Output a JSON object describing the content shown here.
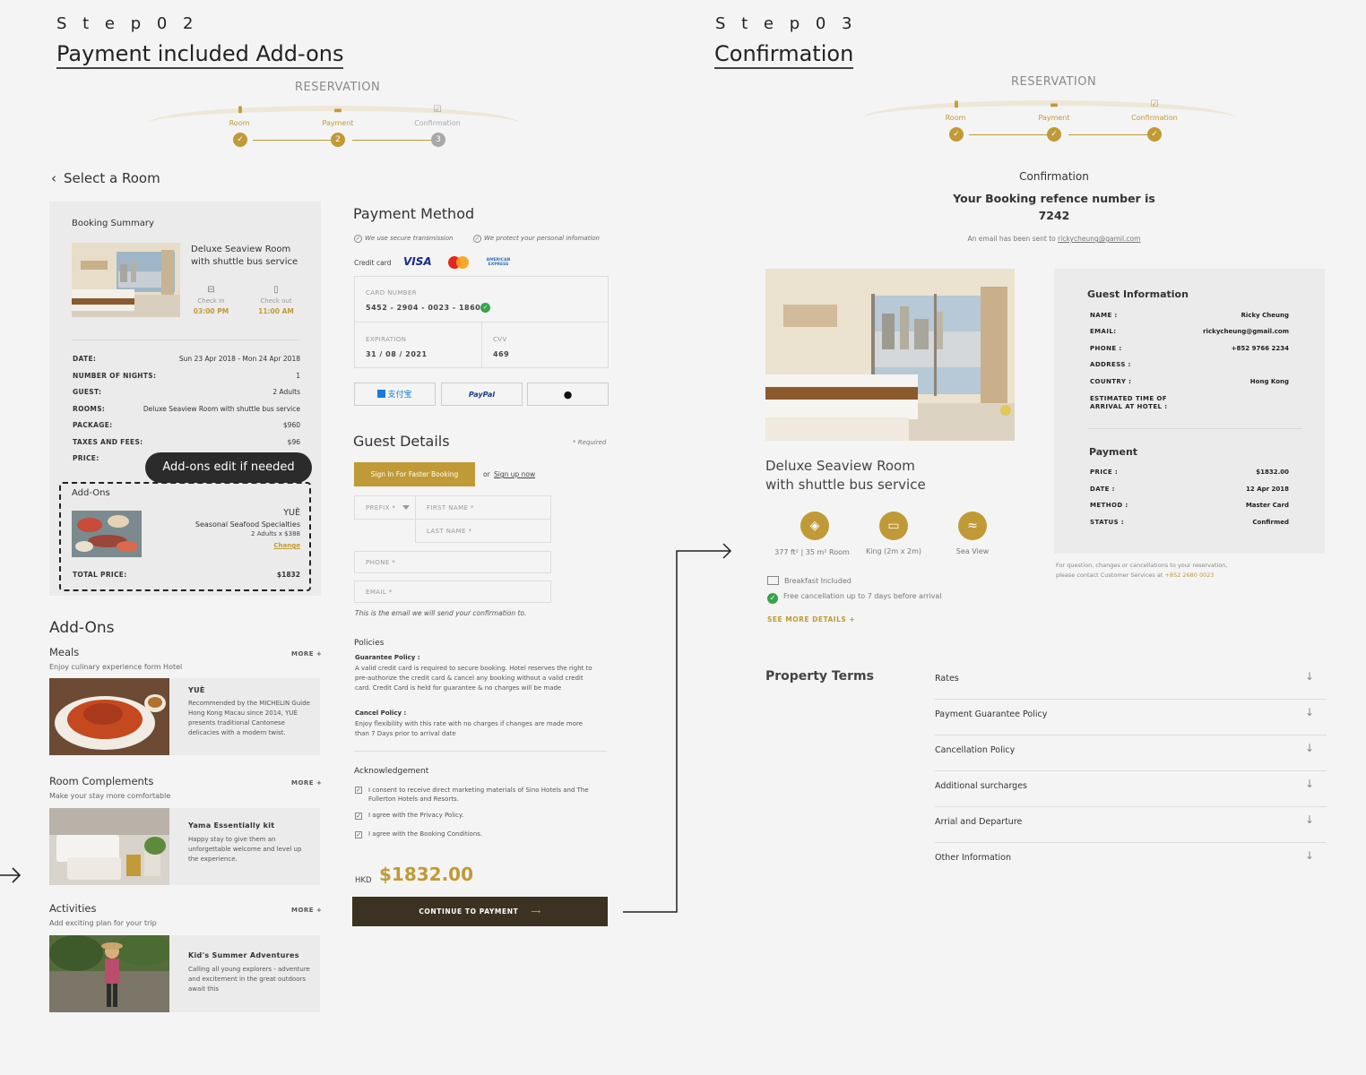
{
  "step2": {
    "label": "S t e p   0 2",
    "title": "Payment included Add-ons",
    "reservation": "RESERVATION",
    "steps": [
      "Room",
      "Payment",
      "Confirmation"
    ],
    "step_nums": [
      "2",
      "3"
    ],
    "back_label": "Select a Room",
    "summary": {
      "title": "Booking Summary",
      "room_name_1": "Deluxe Seaview Room",
      "room_name_2": "with shuttle bus service",
      "checkin_label": "Check in",
      "checkin_time": "03:00 PM",
      "checkout_label": "Check out",
      "checkout_time": "11:00 AM",
      "rows": [
        {
          "k": "DATE:",
          "v": "Sun 23 Apr 2018 - Mon 24 Apr 2018"
        },
        {
          "k": "NUMBER OF NIGHTS:",
          "v": "1"
        },
        {
          "k": "GUEST:",
          "v": "2 Adults"
        },
        {
          "k": "ROOMS:",
          "v": "Deluxe Seaview Room with shuttle bus service"
        },
        {
          "k": "PACKAGE:",
          "v": "$960"
        },
        {
          "k": "TAXES AND FEES:",
          "v": "$96"
        },
        {
          "k": "PRICE:",
          "v": ""
        }
      ],
      "tooltip": "Add-ons edit if needed",
      "addons_label": "Add-Ons",
      "addon_name_1": "YUÈ",
      "addon_name_2": "Seasonal Seafood Specialties",
      "addon_qty": "2 Adults  x   $388",
      "change": "Change",
      "total_label": "TOTAL PRICE:",
      "total_value": "$1832"
    },
    "addons": {
      "heading": "Add-Ons",
      "more": "MORE +",
      "sections": [
        {
          "title": "Meals",
          "sub": "Enjoy culinary experience form Hotel",
          "card_title": "YUÈ",
          "card_desc": "Recommended by the MICHELIN Guide Hong Kong Macau since 2014,  YUÈ presents traditional Cantonese delicacies with a modern twist."
        },
        {
          "title": "Room Complements",
          "sub": "Make your stay more comfortable",
          "card_title": "Yama Essentially kit",
          "card_desc": "Happy stay to give them an unforgettable welcome and level up the experience."
        },
        {
          "title": "Activities",
          "sub": "Add exciting plan for your trip",
          "card_title": "Kid's Summer Adventures",
          "card_desc": "Calling all young explorers - adventure and excitement in the great outdoors await this"
        }
      ]
    },
    "payment": {
      "heading": "Payment Method",
      "secure_1": "We use secure transmission",
      "secure_2": "We protect your personal infomation",
      "credit_label": "Credit card",
      "visa": "VISA",
      "amex": "AMERICAN EXPRESS",
      "card_number_label": "CARD NUMBER",
      "card_number": "5452  -  2904  -  0023  -  1860",
      "expiration_label": "EXPIRATION",
      "expiration": "31 / 08 / 2021",
      "cvv_label": "CVV",
      "cvv": "469",
      "alipay": "支付宝",
      "paypal": "PayPal"
    },
    "guest": {
      "heading": "Guest Details",
      "required": "* Required",
      "signin": "Sign In For Faster Booking",
      "or": "or",
      "signup": "Sign up now",
      "prefix_ph": "PREFIX *",
      "first_ph": "FIRST NAME *",
      "last_ph": "LAST NAME *",
      "phone_ph": "PHONE *",
      "email_ph": "EMAIL *",
      "email_note": "This is the email we will send your confirmation to."
    },
    "policies": {
      "heading": "Policies",
      "g_title": "Guarantee Policy :",
      "g_text": "A valid credit card is required to secure booking. Hotel reserves the right to pre-authorize the credit card & cancel any booking without a valid credit card. Credit Card is held for guarantee & no charges will be made",
      "c_title": "Cancel Policy :",
      "c_text": "Enjoy flexibility with this rate with no charges if changes are made more than 7 Days prior to arrival date"
    },
    "ack": {
      "heading": "Acknowledgement",
      "items": [
        "I consent to receive direct marketing materials of Sino Hotels and The Fullerton Hotels and Resorts.",
        "I agree with the Privacy Policy.",
        "I agree with the Booking Conditions."
      ]
    },
    "total": {
      "currency": "HKD",
      "amount": "$1832.00"
    },
    "continue_label": "CONTINUE TO PAYMENT"
  },
  "step3": {
    "label": "S t e p   0 3",
    "title": "Confirmation",
    "reservation": "RESERVATION",
    "steps": [
      "Room",
      "Payment",
      "Confirmation"
    ],
    "conf_title": "Confirmation",
    "ref_line1": "Your Booking refence number is",
    "ref_number": "7242",
    "email_note": "An email has been sent to",
    "email": "rickycheung@gamil.com",
    "room_name_1": "Deluxe Seaview Room",
    "room_name_2": "with shuttle bus service",
    "features": [
      "377 ft² | 35 m² Room",
      "King (2m x 2m)",
      "Sea View"
    ],
    "breakfast": "Breakfast Included",
    "cancellation": "Free cancellation up to 7 days before arrival",
    "see_more": "SEE MORE DETAILS +",
    "guest_info": {
      "heading": "Guest Information",
      "rows": [
        {
          "k": "NAME :",
          "v": "Ricky Cheung"
        },
        {
          "k": "EMAIL:",
          "v": "rickycheung@gmail.com"
        },
        {
          "k": "PHONE :",
          "v": "+852 9766 2234"
        },
        {
          "k": "ADDRESS :",
          "v": ""
        },
        {
          "k": "COUNTRY :",
          "v": "Hong Kong"
        }
      ],
      "eta_1": "ESTIMATED TIME OF",
      "eta_2": "ARRIVAL AT HOTEL :"
    },
    "payment": {
      "heading": "Payment",
      "rows": [
        {
          "k": "PRICE :",
          "v": "$1832.00"
        },
        {
          "k": "DATE :",
          "v": "12 Apr 2018"
        },
        {
          "k": "METHOD :",
          "v": "Master Card"
        },
        {
          "k": "STATUS :",
          "v": "Confirmed"
        }
      ]
    },
    "contact_1": "For question, changes or cancellations to your reservation,",
    "contact_2": "please contact Customer Services at",
    "contact_phone": "+852 2680 0023",
    "terms_heading": "Property Terms",
    "terms": [
      "Rates",
      "Payment Guarantee Policy",
      "Cancellation Policy",
      "Additional surcharges",
      "Arrial and Departure",
      "Other Information"
    ]
  },
  "colors": {
    "accent": "#c09a36",
    "dark": "#3b3222",
    "panel": "#ebebeb",
    "bg": "#f4f4f4"
  },
  "icons": [
    "lock-icon",
    "card-icon",
    "check-icon",
    "chevron-left-icon",
    "shield-check-icon",
    "checkin-icon",
    "checkout-icon",
    "apple-icon",
    "dropdown-icon",
    "arrow-right-icon",
    "room-size-icon",
    "bed-icon",
    "sea-view-icon",
    "breakfast-icon",
    "check-circle-icon",
    "arrow-down-icon"
  ]
}
